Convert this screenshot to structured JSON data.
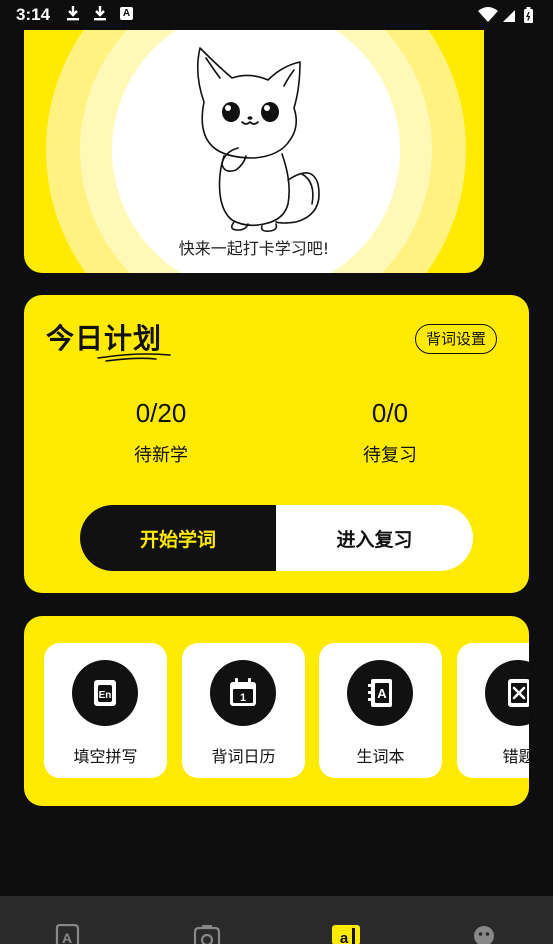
{
  "status_bar": {
    "time": "3:14",
    "notification_icons": [
      "download-icon",
      "download-icon",
      "a-icon"
    ],
    "a_label": "A",
    "system_icons": [
      "wifi-icon",
      "signal-icon",
      "battery-icon"
    ]
  },
  "banner": {
    "caption": "快来一起打卡学习吧!"
  },
  "plan": {
    "title": "今日计划",
    "settings_label": "背词设置",
    "new_count": "0/20",
    "new_label": "待新学",
    "review_count": "0/0",
    "review_label": "待复习",
    "start_button": "开始学词",
    "review_button": "进入复习"
  },
  "tools": [
    {
      "label": "填空拼写",
      "icon": "en-card-icon"
    },
    {
      "label": "背词日历",
      "icon": "calendar-icon"
    },
    {
      "label": "生词本",
      "icon": "notebook-icon"
    },
    {
      "label": "错题",
      "icon": "wrong-question-icon"
    }
  ],
  "tab_bar": {
    "tabs": [
      "text-icon",
      "camera-icon",
      "word-icon",
      "profile-icon"
    ],
    "active_index": 2
  },
  "colors": {
    "accent": "#ffea00",
    "background": "#0e0e0e",
    "dark": "#111111"
  }
}
